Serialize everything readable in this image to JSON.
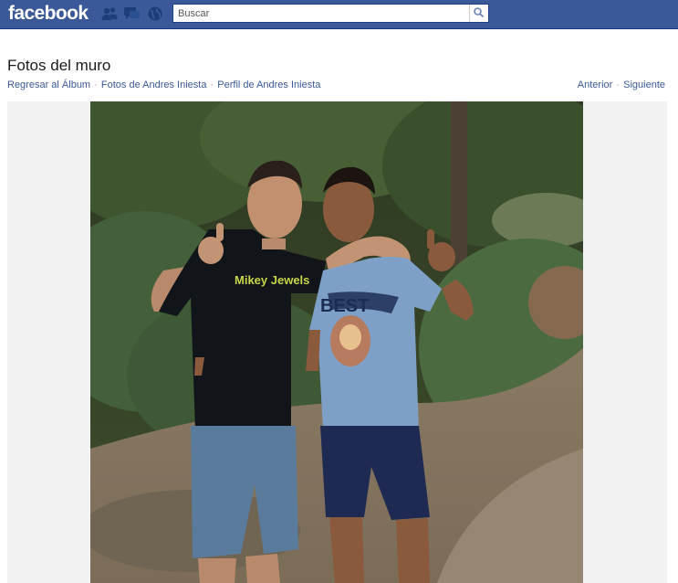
{
  "header": {
    "logo": "facebook",
    "search_placeholder": "Buscar"
  },
  "page": {
    "title": "Fotos del muro",
    "links": [
      "Regresar al Álbum",
      "Fotos de Andres Iniesta",
      "Perfil de Andres Iniesta"
    ],
    "nav": {
      "previous": "Anterior",
      "next": "Siguiente"
    }
  },
  "photo": {
    "shirt_text": "Mikey Jewels",
    "shirt_text_2": "BEST"
  },
  "icons": [
    "friend-requests-icon",
    "messages-icon",
    "notifications-globe-icon",
    "search-icon"
  ],
  "colors": {
    "brand": "#3b5998",
    "link": "#3b5998"
  }
}
